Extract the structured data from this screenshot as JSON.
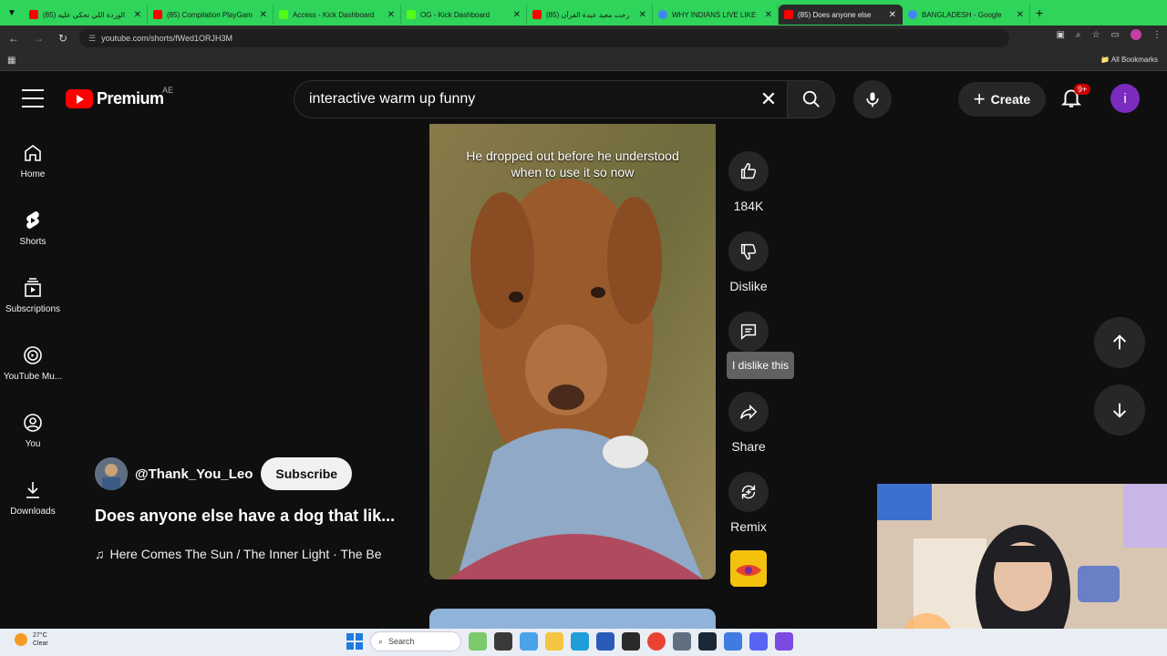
{
  "browser": {
    "tabs": [
      {
        "title": "(85) الوردة اللي تحكي عليه",
        "favicon_color": "#ff0000"
      },
      {
        "title": "(85) Compilation PlayGam",
        "favicon_color": "#ff0000"
      },
      {
        "title": "Access - Kick Dashboard",
        "favicon_color": "#53fc18"
      },
      {
        "title": "OG - Kick Dashboard",
        "favicon_color": "#53fc18"
      },
      {
        "title": "(85) رحت معيد عيدة القرآن",
        "favicon_color": "#ff0000"
      },
      {
        "title": "WHY INDIANS LIVE LIKE",
        "favicon_color": "#4285f4"
      },
      {
        "title": "(85) Does anyone else",
        "favicon_color": "#ff0000"
      },
      {
        "title": "BANGLADESH - Google",
        "favicon_color": "#4285f4"
      }
    ],
    "active_tab_index": 6,
    "url": "youtube.com/shorts/fWed1ORJH3M",
    "bookmarks_label": "All Bookmarks",
    "tab_strip_color": "#2fd45a"
  },
  "header": {
    "logo_text": "Premium",
    "region": "AE",
    "search_value": "interactive warm up funny",
    "create_label": "Create",
    "notif_badge": "9+",
    "avatar_letter": "i"
  },
  "nav": {
    "items": [
      {
        "label": "Home",
        "icon": "home-icon"
      },
      {
        "label": "Shorts",
        "icon": "shorts-icon"
      },
      {
        "label": "Subscriptions",
        "icon": "subscriptions-icon"
      },
      {
        "label": "YouTube Mu...",
        "icon": "youtube-music-icon"
      },
      {
        "label": "You",
        "icon": "you-icon"
      },
      {
        "label": "Downloads",
        "icon": "downloads-icon"
      }
    ]
  },
  "short": {
    "caption": "He dropped out before he understood when to use it so now",
    "channel": "@Thank_You_Leo",
    "subscribe_label": "Subscribe",
    "title": "Does anyone else have a dog that lik...",
    "song": "Here Comes The Sun / The Inner Light · The Be"
  },
  "actions": {
    "like_count": "184K",
    "dislike_label": "Dislike",
    "tooltip": "I dislike this",
    "share_label": "Share",
    "remix_label": "Remix"
  },
  "taskbar": {
    "temperature": "27°C",
    "weather": "Clear",
    "search_placeholder": "Search"
  },
  "colors": {
    "brand_red": "#ff0000",
    "background": "#0f0f0f",
    "chip": "#272727"
  }
}
